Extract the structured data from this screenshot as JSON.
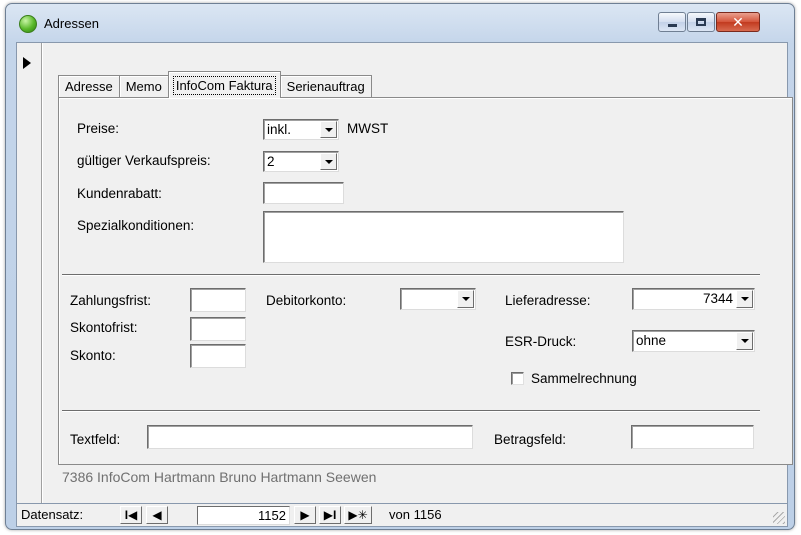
{
  "window": {
    "title": "Adressen",
    "close_glyph": "✕"
  },
  "tabs": [
    {
      "label": "Adresse",
      "active": false
    },
    {
      "label": "Memo",
      "active": false
    },
    {
      "label": "InfoCom Faktura",
      "active": true
    },
    {
      "label": "Serienauftrag",
      "active": false
    }
  ],
  "pricing": {
    "preise_label": "Preise:",
    "preise_value": "inkl.",
    "mwst_label": "MWST",
    "verkaufspreis_label": "gültiger Verkaufspreis:",
    "verkaufspreis_value": "2",
    "kundenrabatt_label": "Kundenrabatt:",
    "kundenrabatt_value": "",
    "spezial_label": "Spezialkonditionen:",
    "spezial_value": ""
  },
  "payment": {
    "zahlungsfrist_label": "Zahlungsfrist:",
    "zahlungsfrist_value": "",
    "skontofrist_label": "Skontofrist:",
    "skontofrist_value": "",
    "skonto_label": "Skonto:",
    "skonto_value": "",
    "debitorkonto_label": "Debitorkonto:",
    "debitorkonto_value": "",
    "lieferadresse_label": "Lieferadresse:",
    "lieferadresse_value": "7344",
    "esr_label": "ESR-Druck:",
    "esr_value": "ohne",
    "sammelrechnung_label": "Sammelrechnung",
    "sammelrechnung_checked": false
  },
  "extra": {
    "textfeld_label": "Textfeld:",
    "textfeld_value": "",
    "betragsfeld_label": "Betragsfeld:",
    "betragsfeld_value": ""
  },
  "record_summary": "7386 InfoCom Hartmann Bruno Hartmann Seewen",
  "navigation": {
    "label": "Datensatz:",
    "current": "1152",
    "of_label": "von",
    "total": "1156",
    "first_glyph": "I◀",
    "prev_glyph": "◀",
    "next_glyph": "▶",
    "last_glyph": "▶I",
    "new_glyph": "▶✳"
  },
  "icons": [
    "app-icon",
    "minimize-icon",
    "maximize-icon",
    "close-icon",
    "record-selector-arrow-icon",
    "dropdown-arrow-icon",
    "nav-first-icon",
    "nav-prev-icon",
    "nav-next-icon",
    "nav-last-icon",
    "nav-new-icon",
    "resize-grip-icon"
  ]
}
